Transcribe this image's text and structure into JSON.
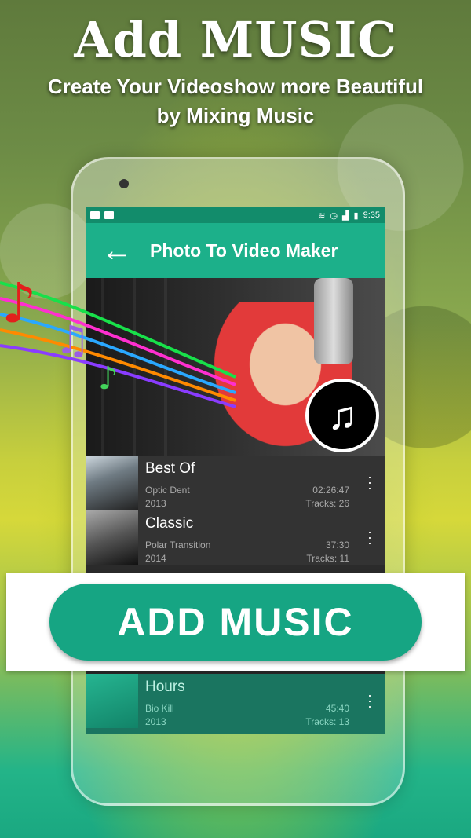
{
  "promo": {
    "headline": "Add MUSIC",
    "subline_1": "Create Your Videoshow more Beautiful",
    "subline_2": "by Mixing Music"
  },
  "statusbar": {
    "time": "9:35"
  },
  "appbar": {
    "title": "Photo To Video Maker",
    "back_icon": "arrow-left-icon"
  },
  "tracks": [
    {
      "title": "Best Of",
      "artist": "Optic Dent",
      "year": "2013",
      "duration": "02:26:47",
      "tracks": "Tracks: 26"
    },
    {
      "title": "Classic",
      "artist": "Polar Transition",
      "year": "2014",
      "duration": "37:30",
      "tracks": "Tracks: 11"
    },
    {
      "title": "Hours",
      "artist": "Bio Kill",
      "year": "2013",
      "duration": "45:40",
      "tracks": "Tracks: 13"
    }
  ],
  "cta": {
    "label": "ADD MUSIC"
  },
  "colors": {
    "accent": "#1cb08a",
    "status": "#128c6b",
    "button": "#16a583"
  }
}
